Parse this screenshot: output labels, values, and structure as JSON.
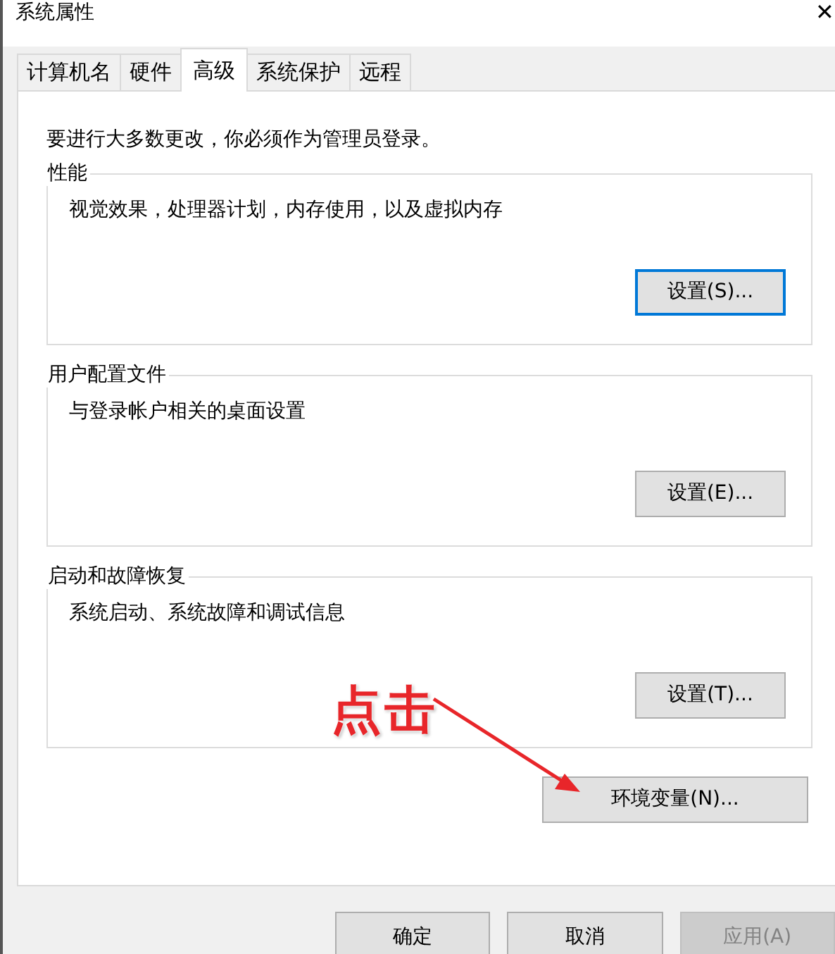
{
  "window": {
    "title": "系统属性",
    "close": "✕"
  },
  "tabs": [
    {
      "label": "计算机名",
      "selected": false
    },
    {
      "label": "硬件",
      "selected": false
    },
    {
      "label": "高级",
      "selected": true
    },
    {
      "label": "系统保护",
      "selected": false
    },
    {
      "label": "远程",
      "selected": false
    }
  ],
  "notice": "要进行大多数更改，你必须作为管理员登录。",
  "groups": [
    {
      "title": "性能",
      "description": "视觉效果，处理器计划，内存使用，以及虚拟内存",
      "button": {
        "label": "设置(S)...",
        "focused": true
      }
    },
    {
      "title": "用户配置文件",
      "description": "与登录帐户相关的桌面设置",
      "button": {
        "label": "设置(E)...",
        "focused": false
      }
    },
    {
      "title": "启动和故障恢复",
      "description": "系统启动、系统故障和调试信息",
      "button": {
        "label": "设置(T)...",
        "focused": false
      }
    }
  ],
  "env_button": {
    "label": "环境变量(N)..."
  },
  "annotation": {
    "text": "点击"
  },
  "footer_buttons": [
    {
      "label": "确定",
      "disabled": false
    },
    {
      "label": "取消",
      "disabled": false
    },
    {
      "label": "应用(A)",
      "disabled": true
    }
  ]
}
